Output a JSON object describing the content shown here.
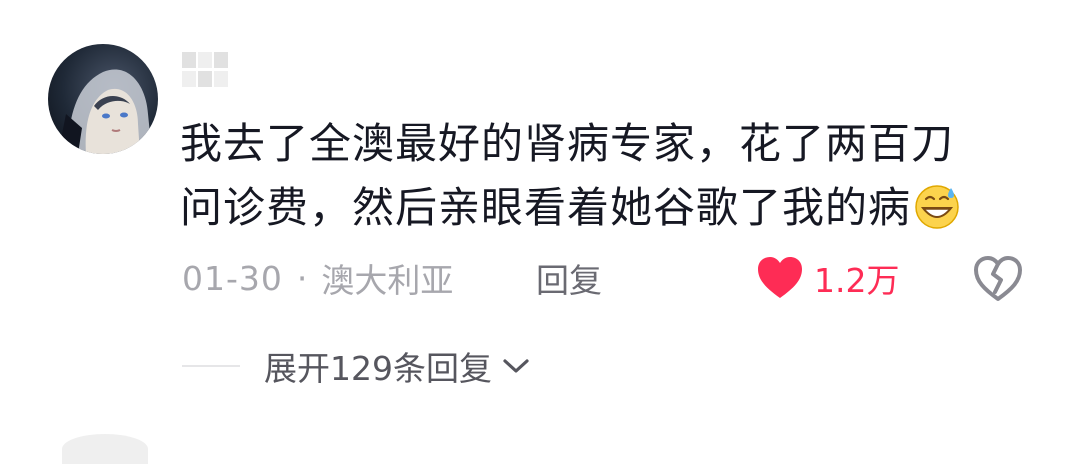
{
  "comment": {
    "text_line1": "我去了全澳最好的肾病专家，花了两百刀",
    "text_line2": "问诊费，然后亲眼看着她谷歌了我的病",
    "emoji": "grinning-sweat-emoji",
    "date": "01-30",
    "separator": "·",
    "location": "澳大利亚",
    "reply_label": "回复",
    "like_count": "1.2万",
    "expand_label": "展开129条回复"
  },
  "icons": {
    "like": "heart-icon",
    "dislike": "broken-heart-icon",
    "expand": "chevron-down-icon"
  },
  "colors": {
    "text": "#161823",
    "meta": "#a7a7ad",
    "like": "#fe2c55",
    "expand": "#56565e"
  }
}
